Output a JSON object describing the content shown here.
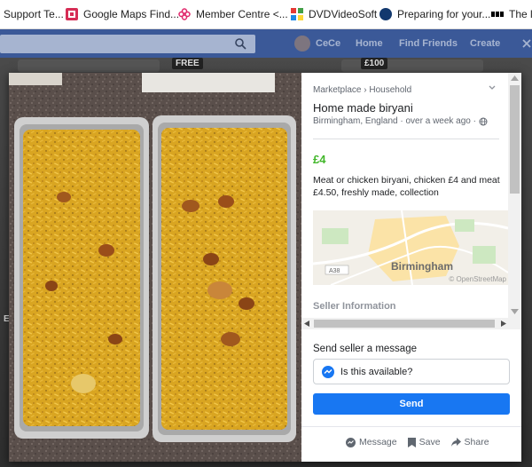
{
  "bookmarks": [
    {
      "label": "Support Te...",
      "icon": "support-icon"
    },
    {
      "label": "Google Maps Find...",
      "icon": "maps-icon",
      "color": "#d62d55"
    },
    {
      "label": "Member Centre <...",
      "icon": "member-centre-icon",
      "color": "#e0276b"
    },
    {
      "label": "DVDVideoSoft",
      "icon": "dvdvideosoft-icon"
    },
    {
      "label": "Preparing for your...",
      "icon": "prepare-icon",
      "color": "#12386e"
    },
    {
      "label": "The la",
      "icon": "bbc-icon"
    }
  ],
  "fb_nav": {
    "user": "CeCe",
    "home": "Home",
    "find_friends": "Find Friends",
    "create": "Create"
  },
  "background": {
    "badge_free": "FREE",
    "badge_price": "£100",
    "side_letters": "EE"
  },
  "listing": {
    "breadcrumb": "Marketplace › Household",
    "title": "Home made biryani",
    "location": "Birmingham, England · over a week ago ·",
    "price": "£4",
    "description": "Meat or chicken biryani,  chicken £4 and meat £4.50, freshly made, collection",
    "map_city": "Birmingham",
    "map_credit": "© OpenStreetMap",
    "map_road": "A38",
    "seller_heading": "Seller Information"
  },
  "message": {
    "heading": "Send seller a message",
    "input_value": "Is this available?",
    "send_label": "Send"
  },
  "actions": {
    "message": "Message",
    "save": "Save",
    "share": "Share"
  },
  "colors": {
    "facebook_blue": "#3b5998",
    "send_button": "#1877f2",
    "price_green": "#42b72a"
  }
}
